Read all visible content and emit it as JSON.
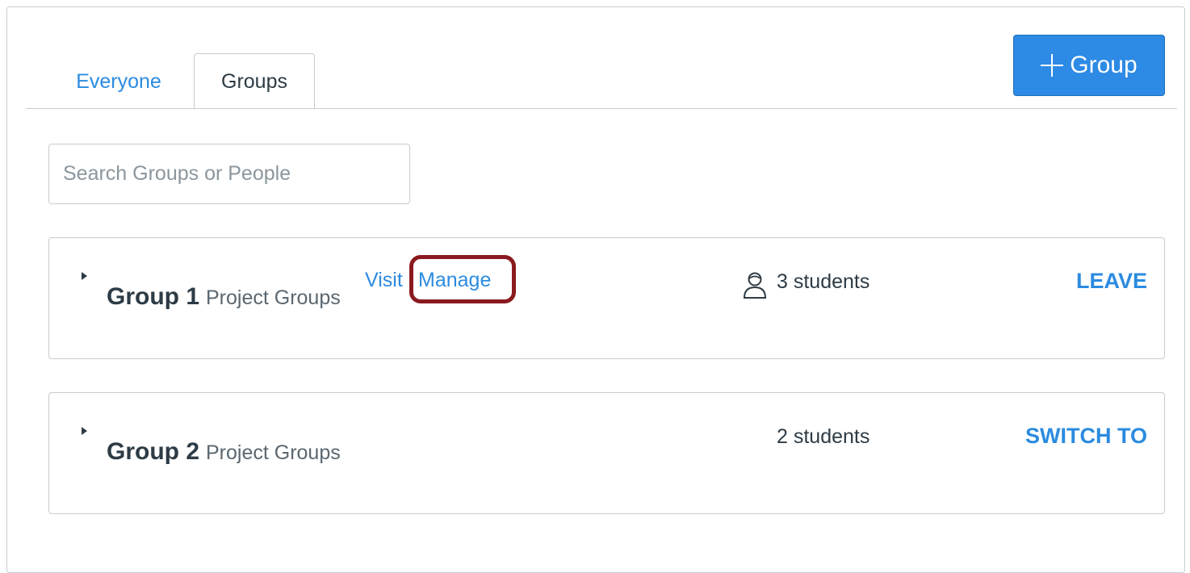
{
  "tabs": [
    {
      "label": "Everyone",
      "active": false
    },
    {
      "label": "Groups",
      "active": true
    }
  ],
  "add_group_button": {
    "label": "Group",
    "icon": "plus-icon"
  },
  "search": {
    "placeholder": "Search Groups or People",
    "value": ""
  },
  "groups": [
    {
      "name": "Group 1",
      "category": "Project Groups",
      "visit_label": "Visit",
      "manage_label": "Manage",
      "member_count": "3 students",
      "icon": "user-icon",
      "action_label": "LEAVE"
    },
    {
      "name": "Group 2",
      "category": "Project Groups",
      "member_count": "2 students",
      "action_label": "SWITCH TO"
    }
  ],
  "colors": {
    "link": "#2b8be0",
    "primary_button": "#2d8ae5",
    "highlight_outline": "#8a1a1f",
    "text": "#2d3b45",
    "border": "#c7cdd1"
  }
}
